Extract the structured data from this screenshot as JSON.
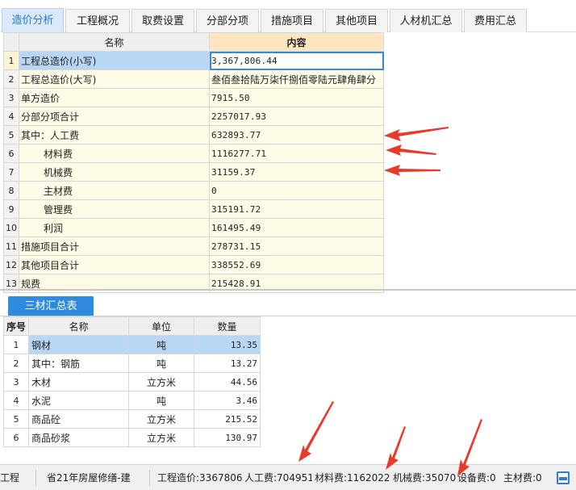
{
  "tabs": [
    {
      "label": "造价分析",
      "active": true
    },
    {
      "label": "工程概况"
    },
    {
      "label": "取费设置"
    },
    {
      "label": "分部分项"
    },
    {
      "label": "措施项目"
    },
    {
      "label": "其他项目"
    },
    {
      "label": "人材机汇总"
    },
    {
      "label": "费用汇总"
    }
  ],
  "main_table": {
    "headers": {
      "name": "名称",
      "content": "内容"
    },
    "rows": [
      {
        "no": "1",
        "name": "工程总造价(小写)",
        "value": "3,367,806.44",
        "selected": true
      },
      {
        "no": "2",
        "name": "工程总造价(大写)",
        "value": "叁佰叁拾陆万柒仟捌佰零陆元肆角肆分"
      },
      {
        "no": "3",
        "name": "单方造价",
        "value": "7915.50"
      },
      {
        "no": "4",
        "name": "分部分项合计",
        "value": "2257017.93"
      },
      {
        "no": "5",
        "name": "其中：人工费",
        "value": "632893.77"
      },
      {
        "no": "6",
        "name": "材料费",
        "value": "1116277.71"
      },
      {
        "no": "7",
        "name": "机械费",
        "value": "31159.37"
      },
      {
        "no": "8",
        "name": "主材费",
        "value": "0"
      },
      {
        "no": "9",
        "name": "管理费",
        "value": "315191.72"
      },
      {
        "no": "10",
        "name": "利润",
        "value": "161495.49"
      },
      {
        "no": "11",
        "name": "措施项目合计",
        "value": "278731.15"
      },
      {
        "no": "12",
        "name": "其他项目合计",
        "value": "338552.69"
      },
      {
        "no": "13",
        "name": "规费",
        "value": "215428.91"
      }
    ]
  },
  "sub_tab": {
    "label": "三材汇总表"
  },
  "materials_table": {
    "headers": {
      "seq": "序号",
      "name": "名称",
      "unit": "单位",
      "qty": "数量"
    },
    "rows": [
      {
        "no": "1",
        "name": "钢材",
        "unit": "吨",
        "qty": "13.35",
        "selected": true
      },
      {
        "no": "2",
        "name": "其中：钢筋",
        "unit": "吨",
        "qty": "13.27"
      },
      {
        "no": "3",
        "name": "木材",
        "unit": "立方米",
        "qty": "44.56"
      },
      {
        "no": "4",
        "name": "水泥",
        "unit": "吨",
        "qty": "3.46"
      },
      {
        "no": "5",
        "name": "商品砼",
        "unit": "立方米",
        "qty": "215.52"
      },
      {
        "no": "6",
        "name": "商品砂浆",
        "unit": "立方米",
        "qty": "130.97"
      }
    ]
  },
  "status_bar": {
    "project_fragment": "工程",
    "quota_name": "省21年房屋修缮-建",
    "total_cost": "工程造价:3367806",
    "labor": "人工费:704951",
    "material": "材料费:1162022",
    "machine": "机械费:35070",
    "equipment": "设备费:0",
    "main_material": "主材费:0",
    "toggle_icon": "panel-icon"
  },
  "colors": {
    "accent": "#2e8be0",
    "active_tab_bg": "#dbe9fa",
    "cell_bg": "#fefbe6",
    "header_highlight": "#fde5c2",
    "selection": "#b9d7f5",
    "arrow": "#e8392b"
  }
}
